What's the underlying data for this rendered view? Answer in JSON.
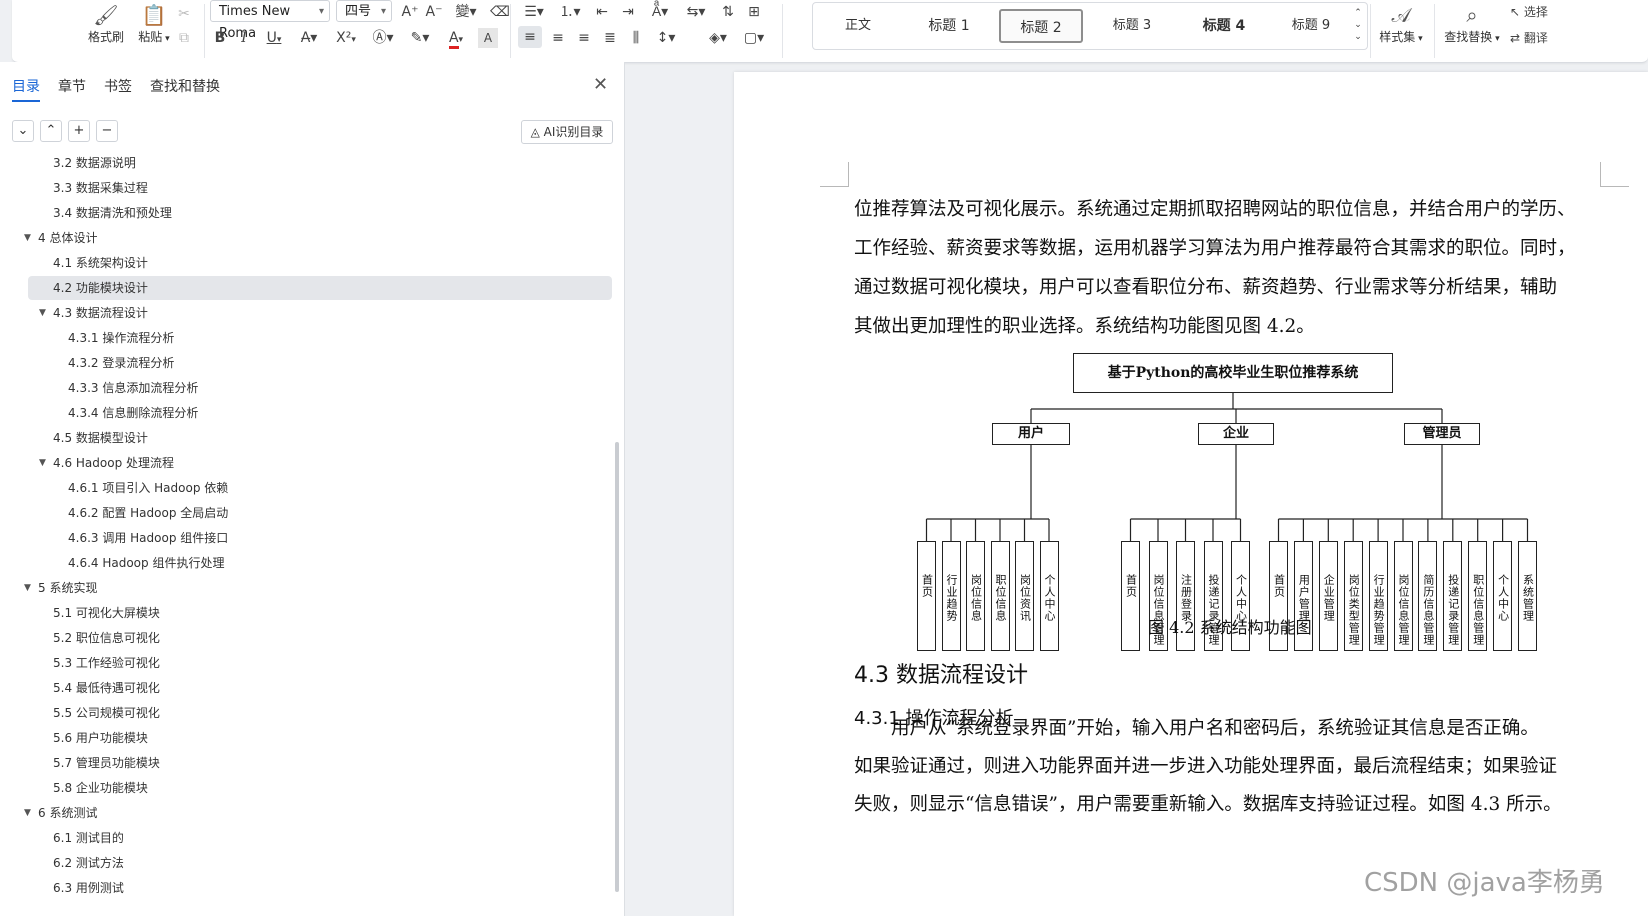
{
  "ribbon": {
    "clipboard": {
      "format_painter": "格式刷",
      "paste": "粘贴"
    },
    "font": {
      "family": "Times New Roma",
      "size": "四号"
    },
    "format": {
      "bold": "B",
      "italic": "I",
      "underline": "U",
      "superscript": "X²",
      "font_color": "A"
    },
    "styles": [
      {
        "label": "正文",
        "active": false
      },
      {
        "label": "标题 1",
        "active": false
      },
      {
        "label": "标题 2",
        "active": true
      },
      {
        "label": "标题 3",
        "active": false
      },
      {
        "label": "标题 4",
        "active": false
      },
      {
        "label": "标题 9",
        "active": false
      }
    ],
    "style_set": "样式集",
    "find_replace": "查找替换",
    "select": "选择",
    "translate": "翻译"
  },
  "sidebar": {
    "tabs": [
      "目录",
      "章节",
      "书签",
      "查找和替换"
    ],
    "ai_toc": "AI识别目录",
    "buttons": {
      "expand": "⌄",
      "collapse": "⌃",
      "add": "+",
      "remove": "−"
    },
    "toc": [
      {
        "label": "3.2 数据源说明",
        "level": 2
      },
      {
        "label": "3.3 数据采集过程",
        "level": 2
      },
      {
        "label": "3.4 数据清洗和预处理",
        "level": 2
      },
      {
        "label": "4 总体设计",
        "level": 1
      },
      {
        "label": "4.1 系统架构设计",
        "level": 2
      },
      {
        "label": "4.2 功能模块设计",
        "level": 2,
        "selected": true
      },
      {
        "label": "4.3 数据流程设计",
        "level": 2,
        "expandable": true
      },
      {
        "label": "4.3.1 操作流程分析",
        "level": 3
      },
      {
        "label": "4.3.2 登录流程分析",
        "level": 3
      },
      {
        "label": "4.3.3 信息添加流程分析",
        "level": 3
      },
      {
        "label": "4.3.4 信息删除流程分析",
        "level": 3
      },
      {
        "label": "4.5 数据模型设计",
        "level": 2
      },
      {
        "label": "4.6 Hadoop 处理流程",
        "level": 2,
        "expandable": true
      },
      {
        "label": "4.6.1 项目引入 Hadoop 依赖",
        "level": 3
      },
      {
        "label": "4.6.2 配置 Hadoop 全局启动",
        "level": 3
      },
      {
        "label": "4.6.3 调用 Hadoop 组件接口",
        "level": 3
      },
      {
        "label": "4.6.4 Hadoop 组件执行处理",
        "level": 3
      },
      {
        "label": "5 系统实现",
        "level": 1
      },
      {
        "label": "5.1 可视化大屏模块",
        "level": 2
      },
      {
        "label": "5.2 职位信息可视化",
        "level": 2
      },
      {
        "label": "5.3 工作经验可视化",
        "level": 2
      },
      {
        "label": "5.4 最低待遇可视化",
        "level": 2
      },
      {
        "label": "5.5 公司规模可视化",
        "level": 2
      },
      {
        "label": "5.6 用户功能模块",
        "level": 2
      },
      {
        "label": "5.7 管理员功能模块",
        "level": 2
      },
      {
        "label": "5.8 企业功能模块",
        "level": 2
      },
      {
        "label": "6 系统测试",
        "level": 1
      },
      {
        "label": "6.1 测试目的",
        "level": 2
      },
      {
        "label": "6.2 测试方法",
        "level": 2
      },
      {
        "label": "6.3 用例测试",
        "level": 2
      }
    ]
  },
  "document": {
    "paragraph1": [
      "位推荐算法及可视化展示。系统通过定期抓取招聘网站的职位信息，并结合用户的学历、",
      "工作经验、薪资要求等数据，运用机器学习算法为用户推荐最符合其需求的职位。同时，",
      "通过数据可视化模块，用户可以查看职位分布、薪资趋势、行业需求等分析结果，辅助",
      "其做出更加理性的职业选择。系统结构功能图见图 4.2。"
    ],
    "figure": {
      "root": "基于Python的高校毕业生职位推荐系统",
      "groups": [
        {
          "name": "用户",
          "items": [
            "首页",
            "行业趋势",
            "岗位信息",
            "职位信息",
            "岗位资讯",
            "个人中心"
          ]
        },
        {
          "name": "企业",
          "items": [
            "首页",
            "岗位信息管理",
            "注册登录",
            "投递记录管理",
            "个人中心"
          ]
        },
        {
          "name": "管理员",
          "items": [
            "首页",
            "用户管理",
            "企业管理",
            "岗位类型管理",
            "行业趋势管理",
            "岗位信息管理",
            "简历信息管理",
            "投递记录管理",
            "职位信息管理",
            "个人中心",
            "系统管理"
          ]
        }
      ],
      "caption": "图 4.2 系统结构功能图"
    },
    "heading_43": "4.3 数据流程设计",
    "heading_431": "4.3.1 操作流程分析",
    "paragraph2": [
      "用户从“系统登录界面”开始，输入用户名和密码后，系统验证其信息是否正确。",
      "如果验证通过，则进入功能界面并进一步进入功能处理界面，最后流程结束；如果验证",
      "失败，则显示“信息错误”，用户需要重新输入。数据库支持验证过程。如图 4.3 所示。"
    ]
  },
  "watermark": "CSDN @java李杨勇"
}
